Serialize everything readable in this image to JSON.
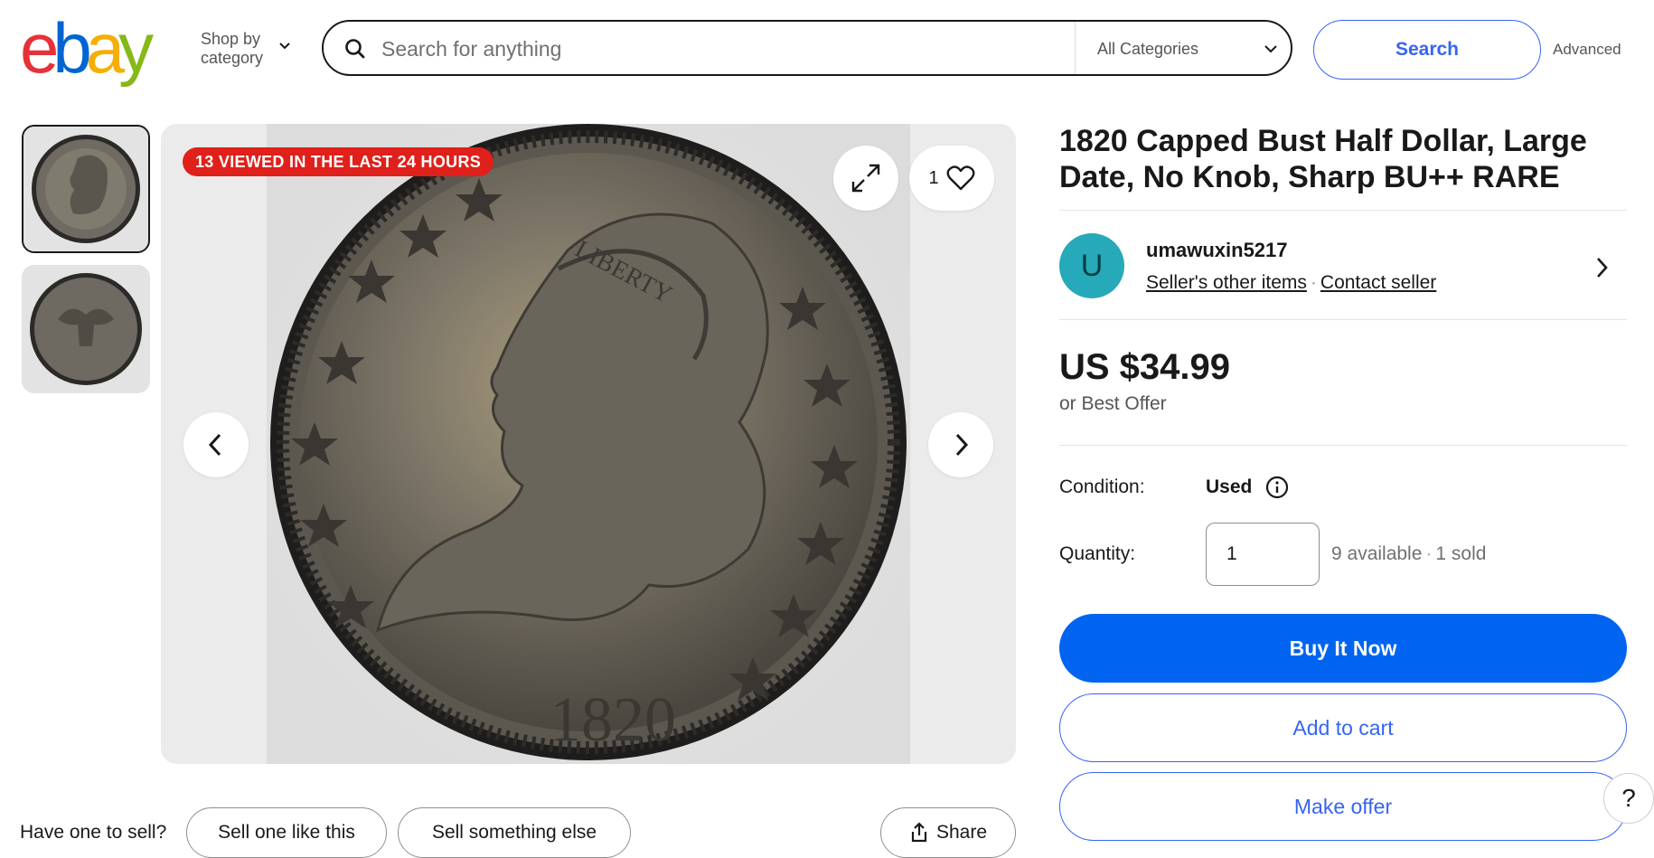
{
  "header": {
    "logo": {
      "e": "e",
      "b": "b",
      "a": "a",
      "y": "y"
    },
    "shop_by": {
      "line1": "Shop by",
      "line2": "category"
    },
    "search": {
      "placeholder": "Search for anything",
      "category": "All Categories",
      "button": "Search",
      "advanced": "Advanced"
    }
  },
  "gallery": {
    "viewed_badge": "13 VIEWED IN THE LAST 24 HOURS",
    "favorites_count": "1",
    "coin_year": "1820",
    "coin_legend": "LIBERTY"
  },
  "listing": {
    "title": "1820 Capped Bust Half Dollar, Large Date, No Knob, Sharp BU++ RARE",
    "seller": {
      "avatar_letter": "U",
      "name": "umawuxin5217",
      "other_items": "Seller's other items",
      "contact": "Contact seller"
    },
    "price": "US $34.99",
    "best_offer": "or Best Offer",
    "condition_label": "Condition:",
    "condition_value": "Used",
    "quantity_label": "Quantity:",
    "quantity_value": "1",
    "available": "9 available",
    "sold": "1 sold",
    "buy_now": "Buy It Now",
    "add_to_cart": "Add to cart",
    "make_offer": "Make offer"
  },
  "sell_bar": {
    "prompt": "Have one to sell?",
    "sell_like": "Sell one like this",
    "sell_else": "Sell something else",
    "share": "Share"
  },
  "help": "?",
  "colors": {
    "accent": "#3665f3",
    "buy_now": "#0064f0",
    "badge": "#e0201a",
    "avatar": "#26a9b8"
  }
}
